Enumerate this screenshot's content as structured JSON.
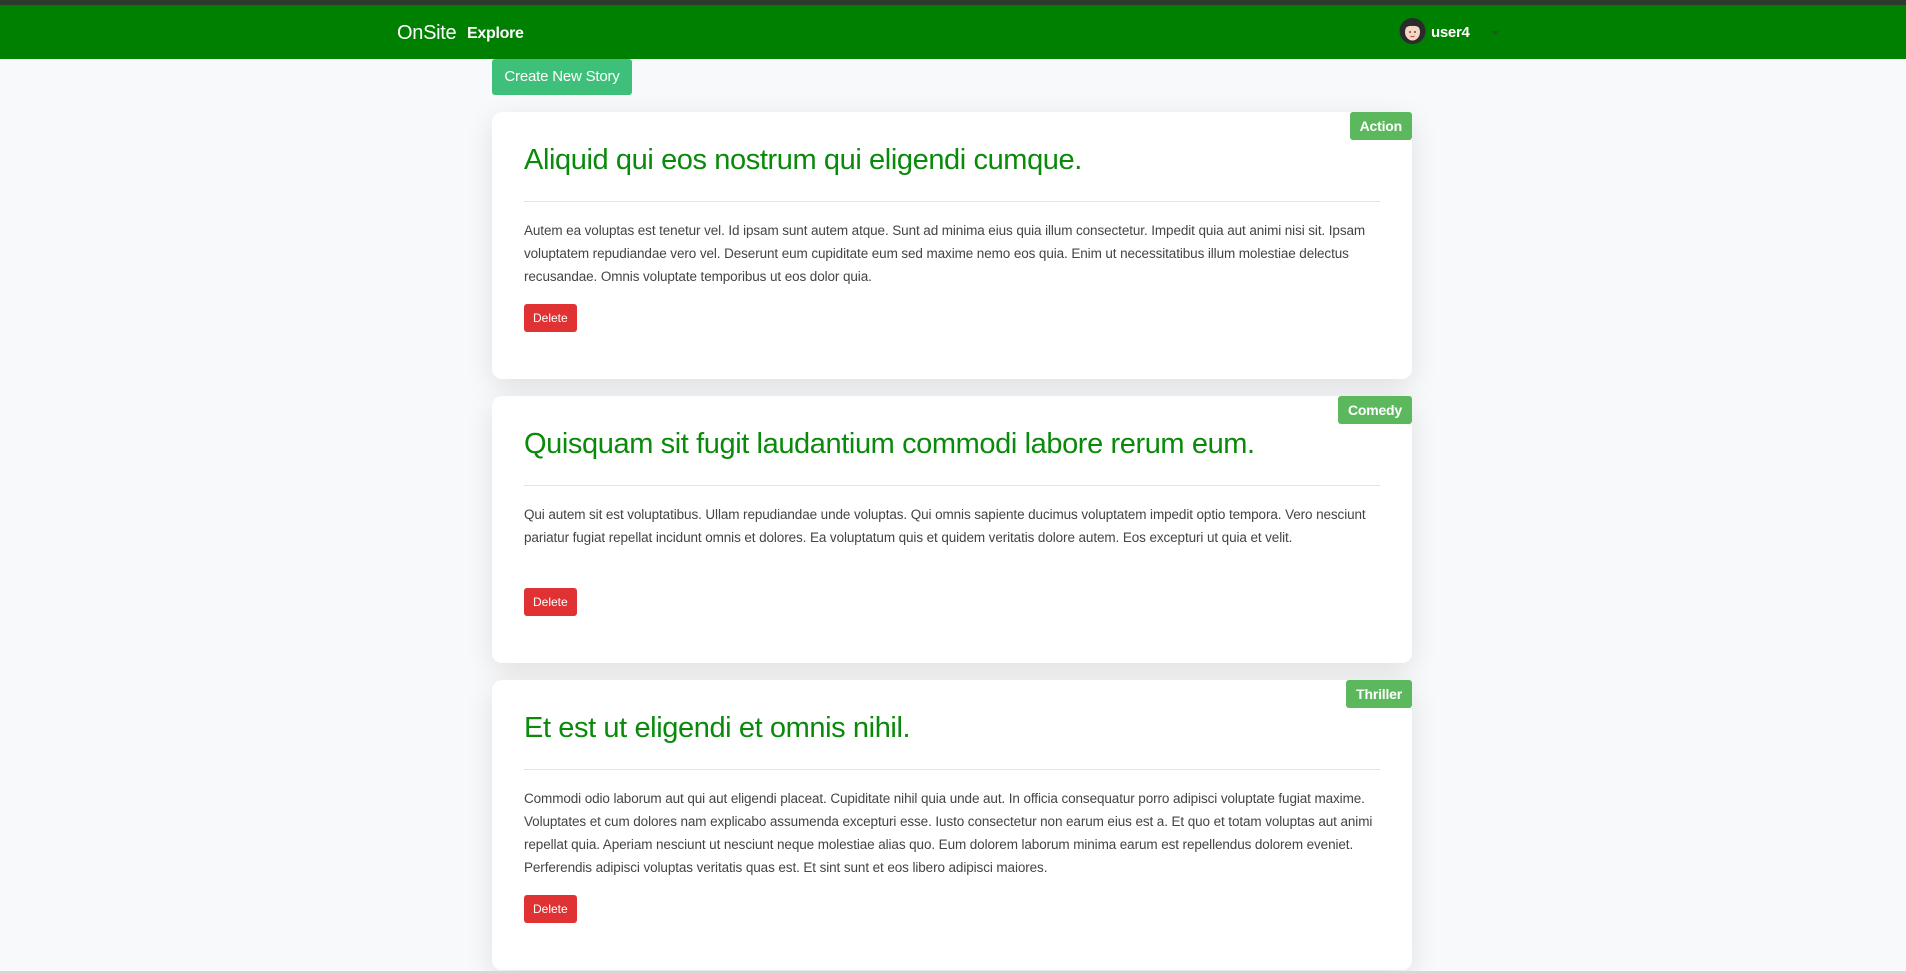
{
  "navbar": {
    "brand": "OnSite",
    "explore": "Explore",
    "user": "user4",
    "colors": {
      "bar": "#008000",
      "text": "#ffffff"
    }
  },
  "actions": {
    "create_label": "Create New Story"
  },
  "stories": [
    {
      "genre": "Action",
      "title": "Aliquid qui eos nostrum qui eligendi cumque.",
      "body": "Autem ea voluptas est tenetur vel. Id ipsam sunt autem atque. Sunt ad minima eius quia illum consectetur. Impedit quia aut animi nisi sit. Ipsam voluptatem repudiandae vero vel. Deserunt eum cupiditate eum sed maxime nemo eos quia. Enim ut necessitatibus illum molestiae delectus recusandae. Omnis voluptate temporibus ut eos dolor quia.",
      "delete_label": "Delete"
    },
    {
      "genre": "Comedy",
      "title": "Quisquam sit fugit laudantium commodi labore rerum eum.",
      "body": "Qui autem sit est voluptatibus. Ullam repudiandae unde voluptas. Qui omnis sapiente ducimus voluptatem impedit optio tempora. Vero nesciunt pariatur fugiat repellat incidunt omnis et dolores. Ea voluptatum quis et quidem veritatis dolore autem. Eos excepturi ut quia et velit.",
      "delete_label": "Delete"
    },
    {
      "genre": "Thriller",
      "title": "Et est ut eligendi et omnis nihil.",
      "body": "Commodi odio laborum aut qui aut eligendi placeat. Cupiditate nihil quia unde aut. In officia consequatur porro adipisci voluptate fugiat maxime. Voluptates et cum dolores nam explicabo assumenda excepturi esse. Iusto consectetur non earum eius est a. Et quo et totam voluptas aut animi repellat quia. Aperiam nesciunt ut nesciunt neque molestiae alias quo. Eum dolorem laborum minima earum est repellendus dolorem eveniet. Perferendis adipisci voluptas veritatis quas est. Et sint sunt et eos libero adipisci maiores.",
      "delete_label": "Delete"
    }
  ],
  "colors": {
    "title": "#0a8a0a",
    "badge": "#5cb85c",
    "delete": "#e03232",
    "create": "#3ec07a"
  }
}
